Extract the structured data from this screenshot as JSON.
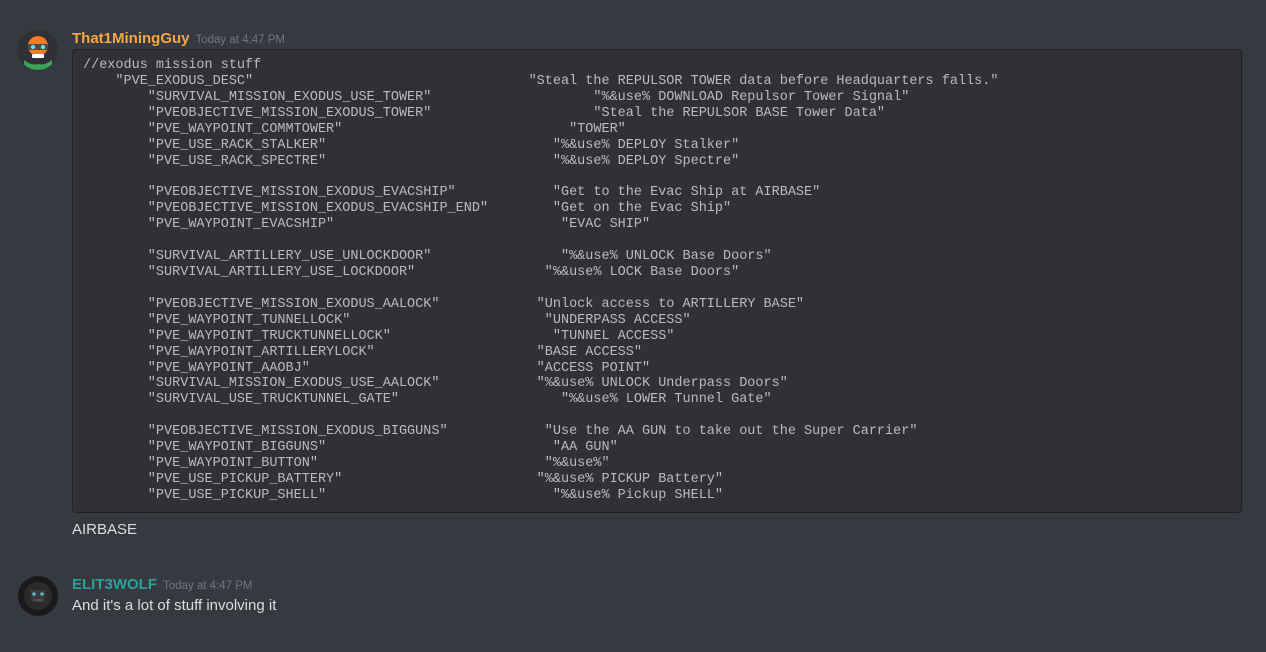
{
  "messages": [
    {
      "username": "That1MiningGuy",
      "usernameClass": "orange",
      "timestamp": "Today at 4:47 PM",
      "codeBlock": "//exodus mission stuff\n    \"PVE_EXODUS_DESC\"                                  \"Steal the REPULSOR TOWER data before Headquarters falls.\"\n        \"SURVIVAL_MISSION_EXODUS_USE_TOWER\"                    \"%&use% DOWNLOAD Repulsor Tower Signal\"\n        \"PVEOBJECTIVE_MISSION_EXODUS_TOWER\"                    \"Steal the REPULSOR BASE Tower Data\"\n        \"PVE_WAYPOINT_COMMTOWER\"                            \"TOWER\"\n        \"PVE_USE_RACK_STALKER\"                            \"%&use% DEPLOY Stalker\"\n        \"PVE_USE_RACK_SPECTRE\"                            \"%&use% DEPLOY Spectre\"\n\n        \"PVEOBJECTIVE_MISSION_EXODUS_EVACSHIP\"            \"Get to the Evac Ship at AIRBASE\"\n        \"PVEOBJECTIVE_MISSION_EXODUS_EVACSHIP_END\"        \"Get on the Evac Ship\"\n        \"PVE_WAYPOINT_EVACSHIP\"                            \"EVAC SHIP\"\n\n        \"SURVIVAL_ARTILLERY_USE_UNLOCKDOOR\"                \"%&use% UNLOCK Base Doors\"\n        \"SURVIVAL_ARTILLERY_USE_LOCKDOOR\"                \"%&use% LOCK Base Doors\"\n\n        \"PVEOBJECTIVE_MISSION_EXODUS_AALOCK\"            \"Unlock access to ARTILLERY BASE\"\n        \"PVE_WAYPOINT_TUNNELLOCK\"                        \"UNDERPASS ACCESS\"\n        \"PVE_WAYPOINT_TRUCKTUNNELLOCK\"                    \"TUNNEL ACCESS\"\n        \"PVE_WAYPOINT_ARTILLERYLOCK\"                    \"BASE ACCESS\"\n        \"PVE_WAYPOINT_AAOBJ\"                            \"ACCESS POINT\"\n        \"SURVIVAL_MISSION_EXODUS_USE_AALOCK\"            \"%&use% UNLOCK Underpass Doors\"\n        \"SURVIVAL_USE_TRUCKTUNNEL_GATE\"                    \"%&use% LOWER Tunnel Gate\"\n\n        \"PVEOBJECTIVE_MISSION_EXODUS_BIGGUNS\"            \"Use the AA GUN to take out the Super Carrier\"\n        \"PVE_WAYPOINT_BIGGUNS\"                            \"AA GUN\"\n        \"PVE_WAYPOINT_BUTTON\"                            \"%&use%\"\n        \"PVE_USE_PICKUP_BATTERY\"                        \"%&use% PICKUP Battery\"\n        \"PVE_USE_PICKUP_SHELL\"                            \"%&use% Pickup SHELL\"",
      "bodyText": "AIRBASE"
    },
    {
      "username": "ELIT3WOLF",
      "usernameClass": "teal",
      "timestamp": "Today at 4:47 PM",
      "bodyText": "And it's a lot of stuff involving it"
    }
  ]
}
